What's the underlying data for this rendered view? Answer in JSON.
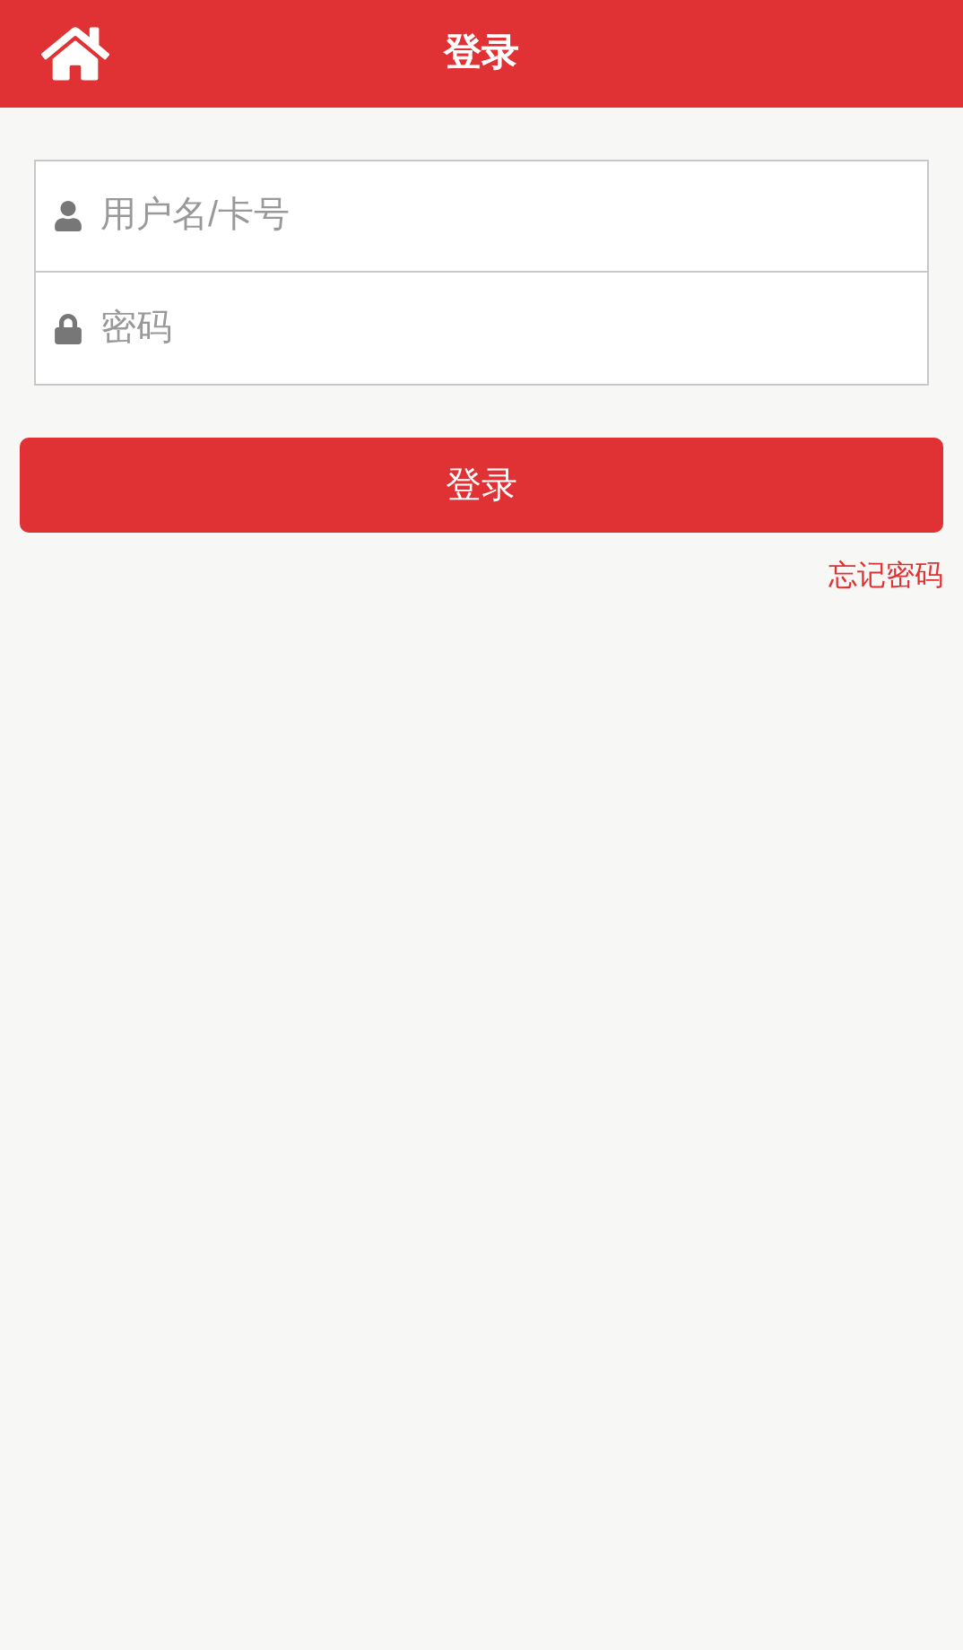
{
  "header": {
    "title": "登录"
  },
  "fields": [
    {
      "kind": "user",
      "placeholder": "用户名/卡号"
    },
    {
      "kind": "password",
      "placeholder": "密码"
    }
  ],
  "submit": "登录",
  "forgot_link": "忘记密码"
}
